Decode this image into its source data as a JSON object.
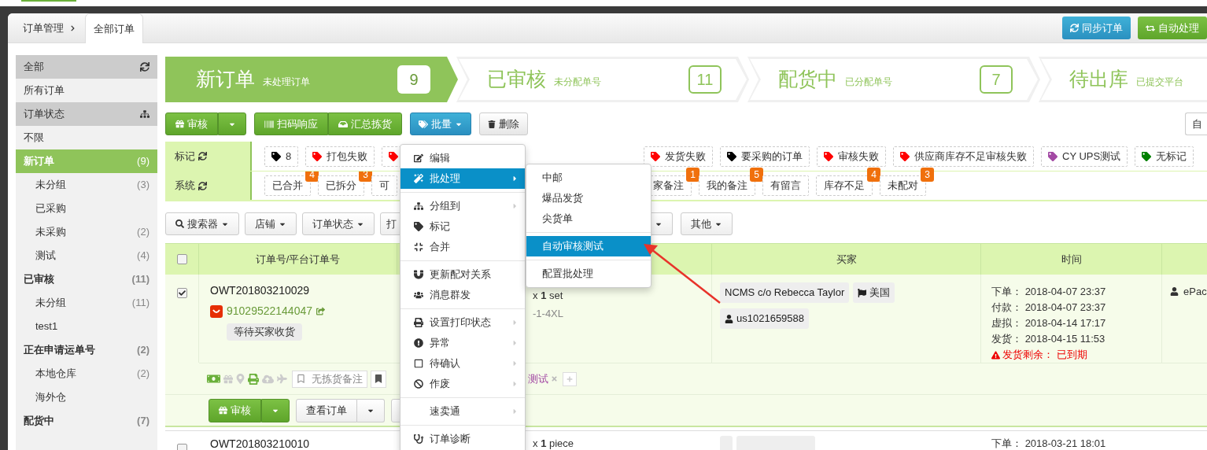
{
  "breadcrumb": {
    "parent": "订单管理",
    "tab": "全部订单"
  },
  "header_buttons": [
    {
      "label": "同步订单",
      "kind": "sync"
    },
    {
      "label": "自动处理",
      "kind": "auto"
    }
  ],
  "sidebar": [
    {
      "label": "全部",
      "kind": "header",
      "selected": false
    },
    {
      "label": "所有订单",
      "kind": "item",
      "selected": false
    },
    {
      "label": "订单状态",
      "kind": "header",
      "selected": false
    },
    {
      "label": "不限",
      "kind": "item",
      "selected": false
    },
    {
      "label": "新订单",
      "count": "(9)",
      "kind": "group",
      "selected": true
    },
    {
      "label": "未分组",
      "count": "(3)",
      "kind": "sub",
      "selected": false
    },
    {
      "label": "已采购",
      "kind": "sub",
      "selected": false
    },
    {
      "label": "未采购",
      "count": "(2)",
      "kind": "sub",
      "selected": false
    },
    {
      "label": "测试",
      "count": "(4)",
      "kind": "sub",
      "selected": false
    },
    {
      "label": "已审核",
      "count": "(11)",
      "kind": "group",
      "selected": false
    },
    {
      "label": "未分组",
      "count": "(11)",
      "kind": "sub",
      "selected": false
    },
    {
      "label": "test1",
      "kind": "sub",
      "selected": false
    },
    {
      "label": "正在申请运单号",
      "count": "(2)",
      "kind": "group",
      "selected": false
    },
    {
      "label": "本地仓库",
      "count": "(2)",
      "kind": "sub",
      "selected": false
    },
    {
      "label": "海外仓",
      "kind": "sub",
      "selected": false
    },
    {
      "label": "配货中",
      "count": "(7)",
      "kind": "group",
      "selected": false
    }
  ],
  "steps": [
    {
      "title": "新订单",
      "subtitle": "未处理订单",
      "count": "9",
      "selected": true
    },
    {
      "title": "已审核",
      "subtitle": "未分配单号",
      "count": "11",
      "selected": false
    },
    {
      "title": "配货中",
      "subtitle": "已分配单号",
      "count": "7",
      "selected": false
    },
    {
      "title": "待出库",
      "subtitle": "已提交平台",
      "selected": false
    }
  ],
  "toolbar": {
    "approve": "审核",
    "scan": "扫码响应",
    "pick": "汇总拣货",
    "batch": "批量",
    "delete": "删除",
    "right": "自"
  },
  "mark_filter": {
    "label": "标记",
    "tags": [
      {
        "label": "8",
        "color": "#000000"
      },
      {
        "label": "打包失败",
        "color": "#ff0000"
      },
      {
        "color": "#ff0000"
      }
    ],
    "tags_after_menu": [
      {
        "label": "发货失败",
        "color": "#ff0000"
      },
      {
        "label": "要采购的订单",
        "color": "#000000"
      },
      {
        "label": "审核失败",
        "color": "#ff0000"
      },
      {
        "label": "供应商库存不足审核失败",
        "color": "#ff0000"
      },
      {
        "label": "CY UPS测试",
        "color": "#a349a4"
      },
      {
        "label": "无标记",
        "color": "#008000"
      }
    ]
  },
  "system_filter": {
    "label": "系统",
    "tags": [
      {
        "label": "已合并",
        "count": "4"
      },
      {
        "label": "已拆分",
        "count": "3"
      },
      {
        "label": "可"
      }
    ],
    "tags_after_menu": [
      {
        "label": "家备注",
        "count": "1"
      },
      {
        "label": "我的备注",
        "count": "5"
      },
      {
        "label": "有留言"
      },
      {
        "label": "库存不足",
        "count": "4"
      },
      {
        "label": "未配对",
        "count": "3"
      }
    ]
  },
  "filters": [
    {
      "label": "搜索器",
      "kind": "search"
    },
    {
      "label": "店铺",
      "kind": "plain"
    },
    {
      "label": "订单状态",
      "kind": "plain"
    },
    {
      "label": "打",
      "kind": "cut"
    }
  ],
  "filters_after_menu": [
    {
      "kind": "caret"
    },
    {
      "label": "其他",
      "kind": "plain"
    }
  ],
  "table": {
    "all_checked": false,
    "columns": [
      "订单号/平台订单号",
      "买家",
      "时间"
    ],
    "rows": [
      {
        "checked": true,
        "order_no": "OWT201803210029",
        "platform_no": "91029522144047",
        "status": "等待买家收货",
        "quantity": "x **1** set",
        "sku": "-1-4XL",
        "buyer": "NCMS c/o Rebecca Taylor",
        "country": "美国",
        "buyer_id": "us1021659588",
        "times": [
          {
            "label": "下单：",
            "value": "2018-04-07 23:37"
          },
          {
            "label": "付款：",
            "value": "2018-04-07 23:37"
          },
          {
            "label": "虚拟：",
            "value": "2018-04-14 17:17"
          },
          {
            "label": "发货：",
            "value": "2018-04-15 11:53"
          }
        ],
        "warning": {
          "label": "发货剩余：",
          "value": "已到期"
        },
        "carrier": "ePac",
        "note": "无拣货备注",
        "tags": [
          {
            "label": "测试",
            "color": "#a349a4"
          }
        ],
        "actions": {
          "approve": "审核",
          "view": "查看订单"
        }
      },
      {
        "checked": false,
        "order_no": "OWT201803210010",
        "quantity": "x **1** piece",
        "times": [
          {
            "label": "下单：",
            "value": "2018-03-21 18:01"
          }
        ]
      }
    ]
  },
  "batch_menu": {
    "sections": [
      [
        {
          "label": "编辑",
          "kind": "edit",
          "submenu": false,
          "selected": false
        },
        {
          "label": "批处理",
          "kind": "wand",
          "submenu": true,
          "selected": true
        }
      ],
      [
        {
          "label": "分组到",
          "kind": "group",
          "submenu": true,
          "selected": false
        },
        {
          "label": "标记",
          "kind": "tag",
          "submenu": false,
          "selected": false
        },
        {
          "label": "合并",
          "kind": "merge",
          "submenu": false,
          "selected": false
        }
      ],
      [
        {
          "label": "更新配对关系",
          "kind": "magnet",
          "submenu": false,
          "selected": false
        },
        {
          "label": "消息群发",
          "kind": "users",
          "submenu": false,
          "selected": false
        }
      ],
      [
        {
          "label": "设置打印状态",
          "kind": "print",
          "submenu": true,
          "selected": false
        },
        {
          "label": "异常",
          "kind": "alert",
          "submenu": true,
          "selected": false
        },
        {
          "label": "待确认",
          "kind": "square",
          "submenu": true,
          "selected": false
        },
        {
          "label": "作废",
          "kind": "ban",
          "submenu": true,
          "selected": false
        }
      ],
      [
        {
          "label": "速卖通",
          "kind": "none",
          "submenu": true,
          "selected": false
        }
      ],
      [
        {
          "label": "订单诊断",
          "kind": "stethoscope",
          "submenu": false,
          "selected": false
        }
      ]
    ]
  },
  "batch_submenu": {
    "sections": [
      [
        {
          "label": "中邮",
          "selected": false
        },
        {
          "label": "爆品发货",
          "selected": false
        },
        {
          "label": "尖货单",
          "selected": false
        }
      ],
      [
        {
          "label": "自动审核测试",
          "selected": true
        }
      ],
      [
        {
          "label": "配置批处理",
          "selected": false
        }
      ]
    ]
  }
}
